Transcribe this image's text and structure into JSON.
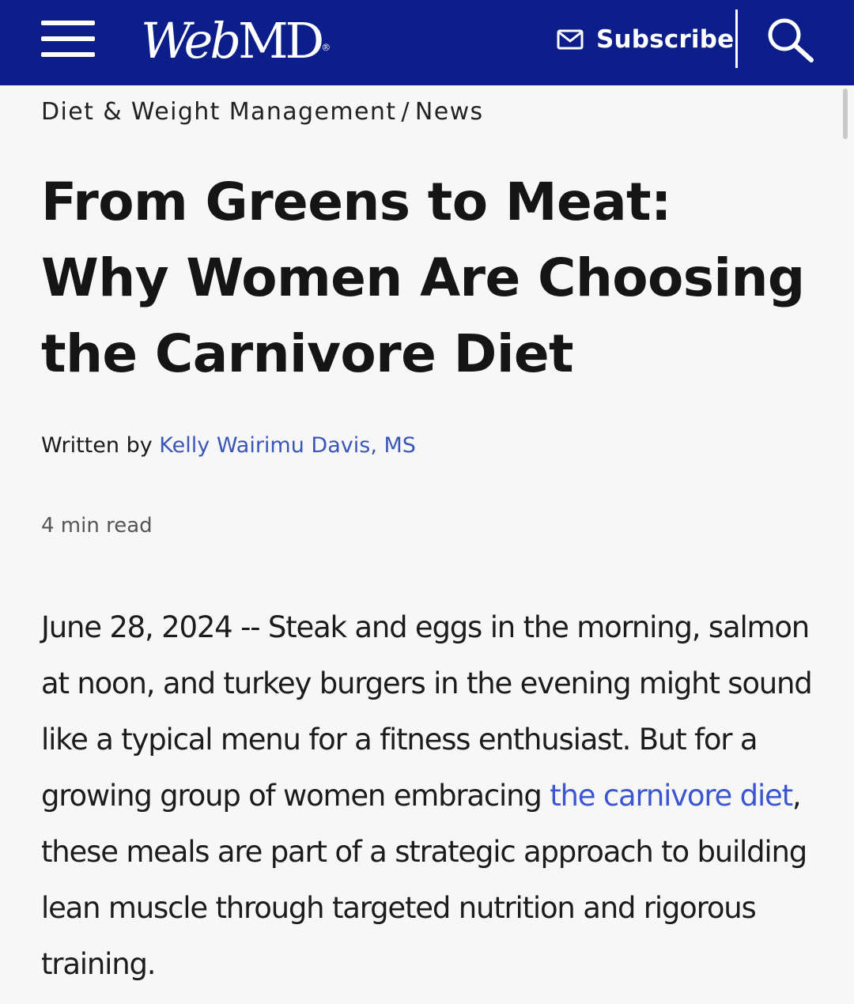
{
  "header": {
    "logo_web": "Web",
    "logo_md": "MD",
    "logo_reg": "®",
    "subscribe_label": "Subscribe",
    "background_color": "#0b1e8a",
    "icons": [
      "menu-icon",
      "mail-icon",
      "search-icon"
    ]
  },
  "breadcrumb": {
    "section": "Diet & Weight Management",
    "separator": "/",
    "subsection": "News"
  },
  "article": {
    "title": "From Greens to Meat: Why Women Are Choosing the Carnivore Diet",
    "byline_prefix": "Written by",
    "author": "Kelly Wairimu Davis, MS",
    "read_time": "4 min read",
    "body_before_link": "June 28, 2024 -- Steak and eggs in the morning, salmon at noon, and turkey burgers in the evening might sound like a typical menu for a fitness enthusiast. But for a growing group of women embracing ",
    "body_link": "the carnivore diet",
    "body_after_link": ", these meals are part of a strategic approach to building lean muscle through targeted nutrition and rigorous training.",
    "link_color": "#3a56d0"
  }
}
